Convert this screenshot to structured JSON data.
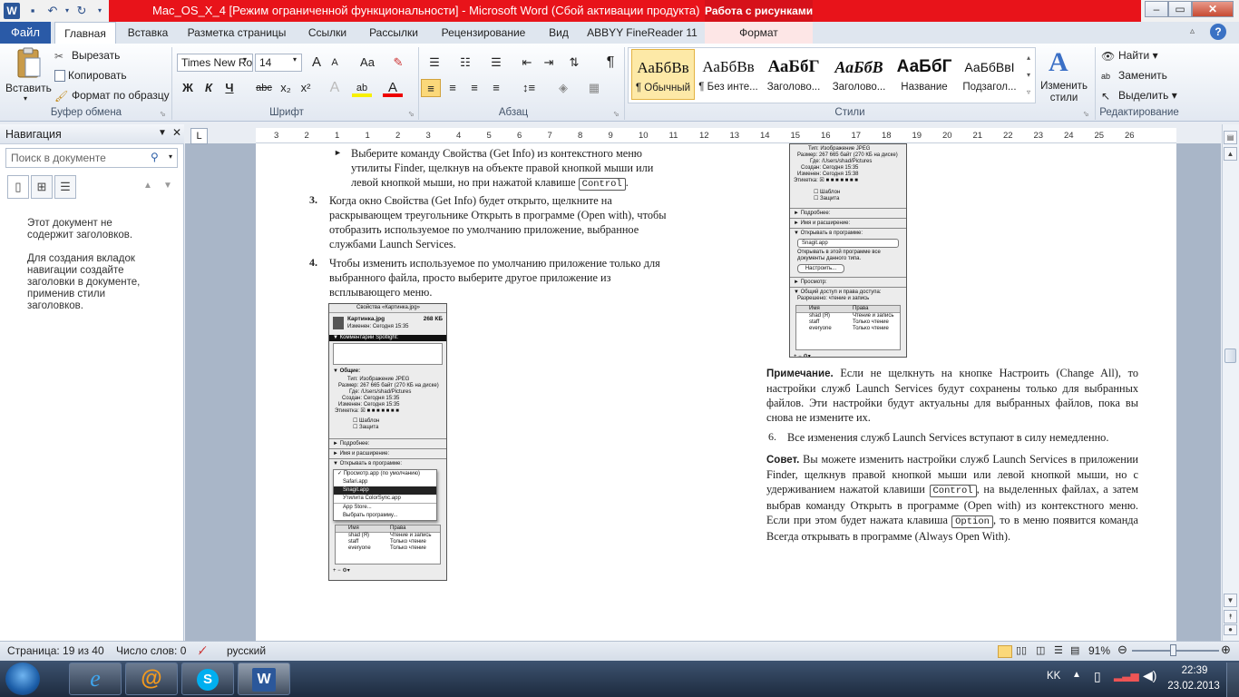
{
  "window": {
    "title": "Mac_OS_X_4 [Режим ограниченной функциональности] - Microsoft Word (Сбой активации продукта)",
    "context_tab_group": "Работа с рисунками"
  },
  "tabs": [
    "Файл",
    "Главная",
    "Вставка",
    "Разметка страницы",
    "Ссылки",
    "Рассылки",
    "Рецензирование",
    "Вид",
    "ABBYY FineReader 11",
    "Формат"
  ],
  "ribbon": {
    "clipboard": {
      "paste": "Вставить",
      "cut": "Вырезать",
      "copy": "Копировать",
      "format_painter": "Формат по образцу",
      "label": "Буфер обмена"
    },
    "font": {
      "name": "Times New Ro",
      "size": "14",
      "label": "Шрифт",
      "grow": "A",
      "shrink": "A",
      "case": "Aa",
      "bold": "Ж",
      "italic": "К",
      "underline": "Ч",
      "strike": "abc",
      "sub": "x₂",
      "sup": "x²"
    },
    "paragraph": {
      "label": "Абзац",
      "pilcrow": "¶"
    },
    "styles": {
      "label": "Стили",
      "items": [
        {
          "sample": "АаБбВв",
          "name": "¶ Обычный"
        },
        {
          "sample": "АаБбВв",
          "name": "¶ Без инте..."
        },
        {
          "sample": "АаБбГ",
          "name": "Заголово..."
        },
        {
          "sample": "АаБбВ",
          "name": "Заголово..."
        },
        {
          "sample": "АаБбГ",
          "name": "Название"
        },
        {
          "sample": "АаБбВвІ",
          "name": "Подзагол..."
        }
      ],
      "change": "Изменить стили"
    },
    "editing": {
      "find": "Найти",
      "replace": "Заменить",
      "select": "Выделить",
      "label": "Редактирование"
    }
  },
  "navigation": {
    "title": "Навигация",
    "search_placeholder": "Поиск в документе",
    "msg1": "Этот документ не содержит заголовков.",
    "msg2": "Для создания вкладок навигации создайте заголовки в документе, применив стили заголовков."
  },
  "ruler": {
    "corner": "L",
    "ticks": [
      "3",
      "2",
      "1",
      "1",
      "2",
      "3",
      "4",
      "5",
      "6",
      "7",
      "8",
      "9",
      "10",
      "11",
      "12",
      "13",
      "14",
      "15",
      "16",
      "17",
      "18",
      "19",
      "20",
      "21",
      "22",
      "23",
      "24",
      "25",
      "26"
    ]
  },
  "document": {
    "bullet": {
      "text": "Выберите команду Свойства (Get Info) из контекстного меню утилиты Finder, щелкнув на объекте правой кнопкой мыши или левой кнопкой мыши, но при нажатой клавише",
      "key": "Control",
      "end": "."
    },
    "step3": {
      "num": "3.",
      "text": "Когда окно Свойства (Get Info) будет открыто, щелкните на раскрывающем треугольнике Открыть в программе (Open with), чтобы отобразить используемое по умолчанию приложение, выбранное службами Launch Services."
    },
    "step4": {
      "num": "4.",
      "text": "Чтобы изменить используемое по умолчанию приложение только для выбранного файла, просто выберите другое приложение из всплывающего меню."
    },
    "note": {
      "label": "Примечание.",
      "text": "Если не щелкнуть на кнопке Настроить (Change All), то настройки служб Launch Services будут сохранены только для выбранных файлов. Эти настройки будут актуальны для выбранных файлов, пока вы снова не измените их."
    },
    "step6": {
      "num": "6.",
      "text": "Все изменения служб Launch Services вступают в силу немедленно."
    },
    "tip": {
      "label": "Совет.",
      "t1": "Вы можете изменить настройки служб Launch Services в приложении Finder, щелкнув правой кнопкой мыши или левой кнопкой мыши, но с удерживанием нажатой клавиши",
      "key1": "Control",
      "t2": ", на выделенных файлах, а затем выбрав команду Открыть в программе (Open with) из контекстного меню. Если при этом будет нажата клавиша",
      "key2": "Option",
      "t3": ", то в меню появится команда Всегда открывать в программе (Always Open With)."
    },
    "left_image": {
      "title": "Свойства «Картинка.jpg»",
      "file": "Картинка.jpg",
      "size": "268 КБ",
      "modified": "Изменен: Сегодня 15:35",
      "spotlight": "▼ Комментарии Spotlight:",
      "general": "▼ Общие:",
      "type": "Тип: Изображение JPEG",
      "fsize": "Размер: 267 665 байт (270 КБ на диске)",
      "where": "Где: /Users/shad/Pictures",
      "created": "Создан: Сегодня 15:35",
      "changed": "Изменен: Сегодня 15:35",
      "label": "Этикетка:",
      "template": "Шаблон",
      "locked": "Защита",
      "more": "► Подробнее:",
      "name_ext": "► Имя и расширение:",
      "open_with": "▼ Открывать в программе:",
      "menu": [
        "✓ Просмотр.app (по умолчанию)",
        "Safari.app",
        "Snagit.app",
        "Утилита ColorSync.app",
        "App Store...",
        "Выбрать программу..."
      ],
      "perm_head": [
        "Имя",
        "Права"
      ],
      "perms": [
        [
          "shad (Я)",
          "Чтение и запись"
        ],
        [
          "staff",
          "Только чтение"
        ],
        [
          "everyone",
          "Только чтение"
        ]
      ]
    },
    "right_image": {
      "type": "Тип: Изображение JPEG",
      "fsize": "Размер: 267 665 байт (270 КБ на диске)",
      "where": "Где: /Users/shad/Pictures",
      "created": "Создан: Сегодня 15:35",
      "changed": "Изменен: Сегодня 15:38",
      "label": "Этикетка:",
      "template": "Шаблон",
      "locked": "Защита",
      "more": "► Подробнее:",
      "name_ext": "► Имя и расширение:",
      "open_with": "▼ Открывать в программе:",
      "app": "Snagit.app",
      "open_note": "Открывать в этой программе все документы данного типа.",
      "change_all": "Настроить...",
      "preview": "► Просмотр:",
      "sharing": "▼ Общий доступ и права доступа:",
      "permitted": "Разрешено: чтение и запись",
      "perm_head": [
        "Имя",
        "Права"
      ],
      "perms": [
        [
          "shad (Я)",
          "Чтение и запись"
        ],
        [
          "staff",
          "Только чтение"
        ],
        [
          "everyone",
          "Только чтение"
        ]
      ]
    }
  },
  "status": {
    "page": "Страница: 19 из 40",
    "words": "Число слов: 0",
    "lang": "русский",
    "zoom": "91%"
  },
  "taskbar": {
    "lang": "KK",
    "time": "22:39",
    "date": "23.02.2013"
  }
}
